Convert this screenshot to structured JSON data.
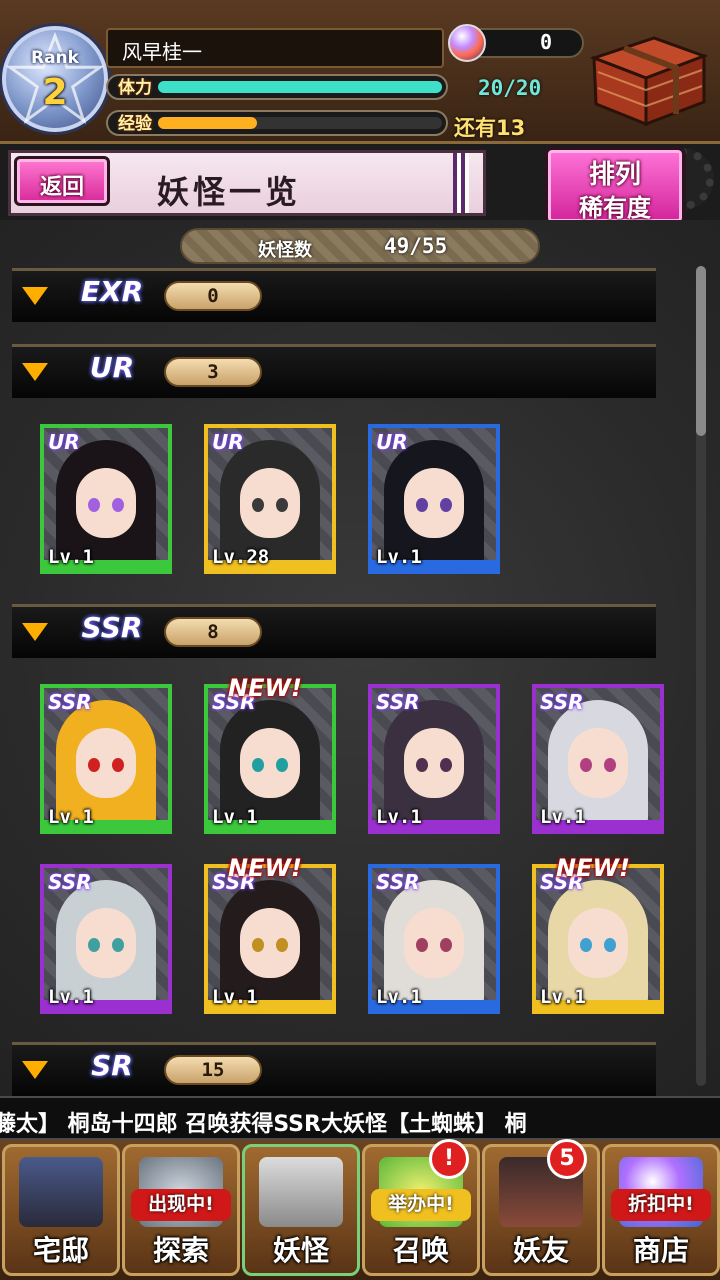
{
  "player": {
    "rank_label": "Rank",
    "rank_value": "2",
    "name": "风早桂一",
    "stamina_label": "体力",
    "stamina_value": "20/20",
    "stamina_ratio": 1.0,
    "exp_label": "经验",
    "exp_remaining": "还有13",
    "exp_ratio": 0.35,
    "gems": "0"
  },
  "header": {
    "back_label": "返回",
    "title": "妖怪一览",
    "sort_line1": "排列",
    "sort_line2": "稀有度"
  },
  "summary": {
    "count_label": "妖怪数",
    "count_value": "49/55"
  },
  "sections": [
    {
      "label": "EXR",
      "count": "0"
    },
    {
      "label": "UR",
      "count": "3"
    },
    {
      "label": "SSR",
      "count": "8"
    },
    {
      "label": "SR",
      "count": "15"
    }
  ],
  "ur_cards": [
    {
      "rarity": "UR",
      "level": "Lv.1",
      "new": ""
    },
    {
      "rarity": "UR",
      "level": "Lv.28",
      "new": ""
    },
    {
      "rarity": "UR",
      "level": "Lv.1",
      "new": ""
    }
  ],
  "ssr_cards": [
    {
      "rarity": "SSR",
      "level": "Lv.1",
      "new": ""
    },
    {
      "rarity": "SSR",
      "level": "Lv.1",
      "new": "NEW!"
    },
    {
      "rarity": "SSR",
      "level": "Lv.1",
      "new": ""
    },
    {
      "rarity": "SSR",
      "level": "Lv.1",
      "new": ""
    },
    {
      "rarity": "SSR",
      "level": "Lv.1",
      "new": ""
    },
    {
      "rarity": "SSR",
      "level": "Lv.1",
      "new": "NEW!"
    },
    {
      "rarity": "SSR",
      "level": "Lv.1",
      "new": ""
    },
    {
      "rarity": "SSR",
      "level": "Lv.1",
      "new": "NEW!"
    }
  ],
  "ticker": "藤太】 桐岛十四郎 召唤获得SSR大妖怪【土蜘蛛】 桐",
  "nav": [
    {
      "label": "宅邸",
      "tag": "",
      "badge": ""
    },
    {
      "label": "探索",
      "tag": "出现中!",
      "badge": ""
    },
    {
      "label": "妖怪",
      "tag": "",
      "badge": ""
    },
    {
      "label": "召唤",
      "tag": "举办中!",
      "badge": "!"
    },
    {
      "label": "妖友",
      "tag": "",
      "badge": "5"
    },
    {
      "label": "商店",
      "tag": "折扣中!",
      "badge": ""
    }
  ],
  "colors": {
    "stamina": "#3fe0c8",
    "exp": "#ffb020",
    "green_frame": "#3cc83c",
    "gold_frame": "#f0c020",
    "blue_frame": "#2a6ae0",
    "purple_frame": "#9a30d0"
  }
}
